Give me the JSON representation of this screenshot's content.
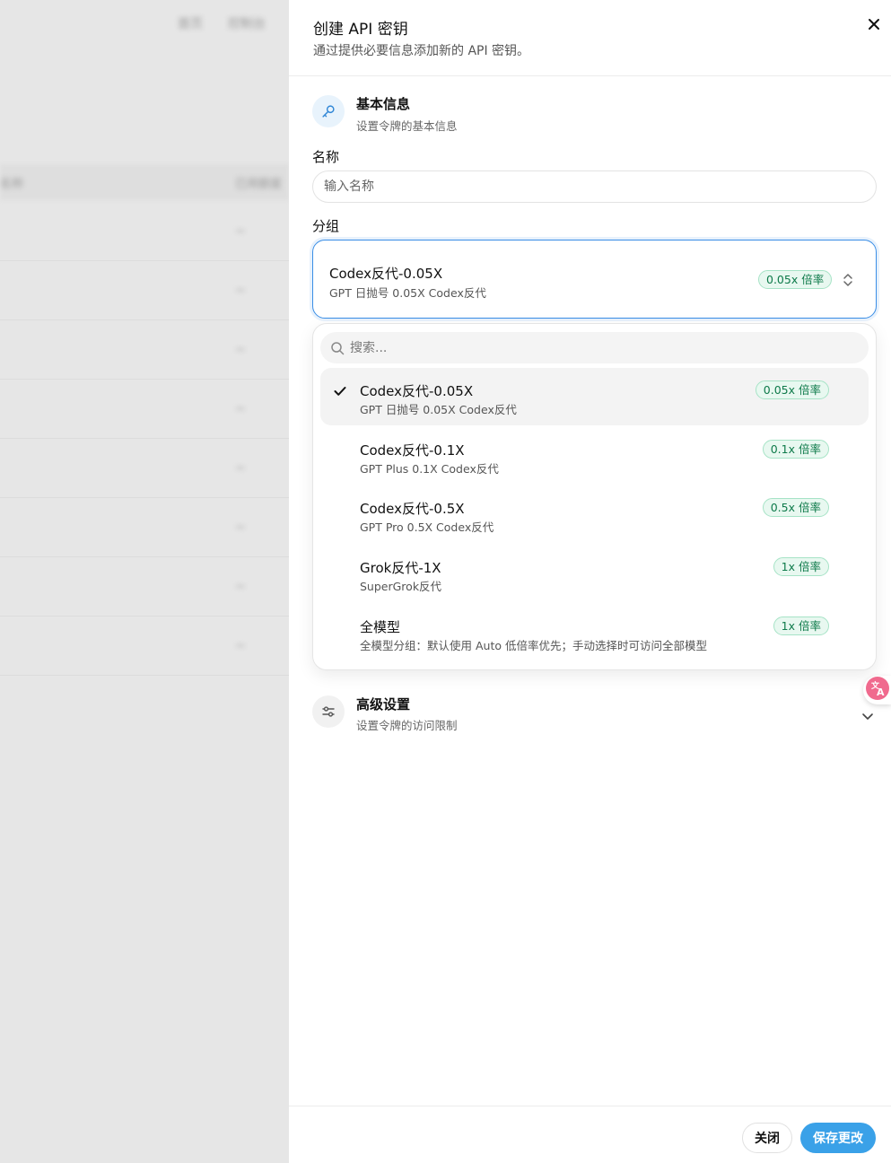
{
  "backdrop": {
    "header_links": [
      "首页",
      "控制台"
    ],
    "table_header": [
      "名称",
      "已用额度"
    ],
    "row_values": [
      "~",
      "~",
      "~",
      "~",
      "~",
      "~",
      "~",
      "~"
    ]
  },
  "drawer": {
    "title": "创建 API 密钥",
    "subtitle": "通过提供必要信息添加新的 API 密钥。",
    "close_icon": "close-icon"
  },
  "basic_section": {
    "icon": "key-icon",
    "title": "基本信息",
    "subtitle": "设置令牌的基本信息"
  },
  "name_field": {
    "label": "名称",
    "placeholder": "输入名称",
    "value": ""
  },
  "group_field": {
    "label": "分组",
    "selected": {
      "title": "Codex反代-0.05X",
      "desc": "GPT 日抛号 0.05X Codex反代",
      "badge": "0.05x 倍率"
    },
    "chevron_icon": "chevron-up-down-icon"
  },
  "dropdown": {
    "search_placeholder": "搜索...",
    "search_icon": "search-icon",
    "check_icon": "check-icon",
    "options": [
      {
        "title": "Codex反代-0.05X",
        "desc": "GPT 日抛号 0.05X Codex反代",
        "badge": "0.05x 倍率",
        "selected": true
      },
      {
        "title": "Codex反代-0.1X",
        "desc": "GPT Plus 0.1X Codex反代",
        "badge": "0.1x 倍率",
        "selected": false
      },
      {
        "title": "Codex反代-0.5X",
        "desc": "GPT Pro 0.5X Codex反代",
        "badge": "0.5x 倍率",
        "selected": false
      },
      {
        "title": "Grok反代-1X",
        "desc": "SuperGrok反代",
        "badge": "1x 倍率",
        "selected": false
      },
      {
        "title": "全模型",
        "desc": "全模型分组：默认使用 Auto 低倍率优先；手动选择时可访问全部模型",
        "badge": "1x 倍率",
        "selected": false
      }
    ]
  },
  "advanced_section": {
    "icon": "sliders-icon",
    "title": "高级设置",
    "subtitle": "设置令牌的访问限制",
    "expand_icon": "chevron-down-icon"
  },
  "footer": {
    "close_label": "关闭",
    "save_label": "保存更改"
  },
  "translate_fab": {
    "icon": "translate-icon"
  },
  "colors": {
    "accent": "#3a8ee6",
    "primary_button": "#3aa1e8",
    "badge_bg": "#e8f8f0",
    "badge_text": "#0e7a4a"
  }
}
